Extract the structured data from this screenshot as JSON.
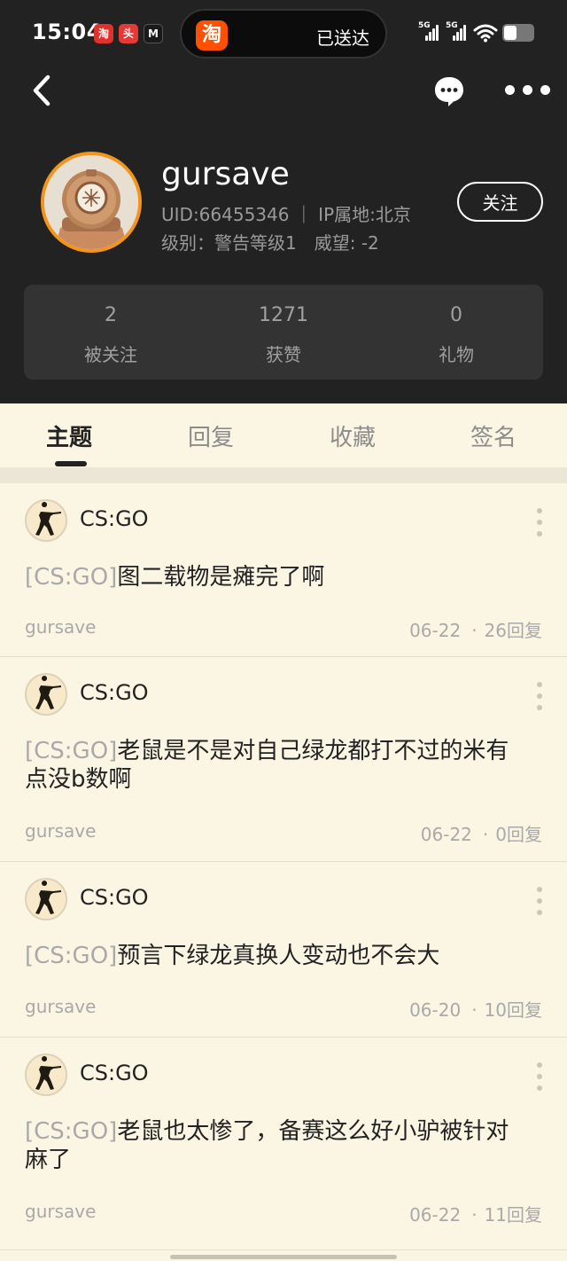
{
  "status_bar": {
    "time": "15:04",
    "mini_apps": [
      {
        "name": "red-app-icon",
        "glyph": "淘",
        "color": "#e2312a"
      },
      {
        "name": "news-app-icon",
        "glyph": "头",
        "color": "#e53935"
      },
      {
        "name": "m-app-icon",
        "glyph": "M",
        "color": "#1a1a1a"
      }
    ],
    "island_app_glyph": "淘",
    "island_text": "已送达",
    "signal_labels": [
      "5G",
      "5G"
    ],
    "battery_level": 0.45
  },
  "profile": {
    "username": "gursave",
    "uid_line": "UID:66455346 ｜ IP属地:北京",
    "level_label": "级别：警告等级1",
    "reputation_label": "威望: -2",
    "follow_label": "关注"
  },
  "stats": [
    {
      "value": "2",
      "label": "被关注"
    },
    {
      "value": "1271",
      "label": "获赞"
    },
    {
      "value": "0",
      "label": "礼物"
    }
  ],
  "tabs": [
    {
      "label": "主题",
      "active": true
    },
    {
      "label": "回复",
      "active": false
    },
    {
      "label": "收藏",
      "active": false
    },
    {
      "label": "签名",
      "active": false
    }
  ],
  "posts": [
    {
      "forum": "CS:GO",
      "tag": "[CS:GO]",
      "title": "图二载物是瘫完了啊",
      "author": "gursave",
      "date": "06-22",
      "replies": "26回复"
    },
    {
      "forum": "CS:GO",
      "tag": "[CS:GO]",
      "title": "老鼠是不是对自己绿龙都打不过的米有点没b数啊",
      "author": "gursave",
      "date": "06-22",
      "replies": "0回复"
    },
    {
      "forum": "CS:GO",
      "tag": "[CS:GO]",
      "title": "预言下绿龙真换人变动也不会大",
      "author": "gursave",
      "date": "06-20",
      "replies": "10回复"
    },
    {
      "forum": "CS:GO",
      "tag": "[CS:GO]",
      "title": "老鼠也太惨了，备赛这么好小驴被针对麻了",
      "author": "gursave",
      "date": "06-22",
      "replies": "11回复"
    }
  ],
  "colors": {
    "header_bg": "#222222",
    "page_bg": "#fbf5e4",
    "avatar_ring": "#f3941d",
    "muted_text": "#a9a9a9"
  }
}
